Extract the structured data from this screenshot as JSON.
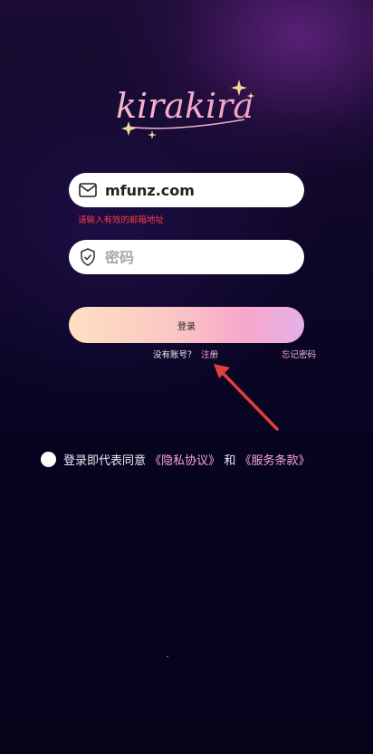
{
  "brand": {
    "logo_text": "kirakira"
  },
  "email": {
    "value": "mfunz.com",
    "icon": "mail-icon",
    "error": "请输入有效的邮箱地址"
  },
  "password": {
    "placeholder": "密码",
    "icon": "shield-icon"
  },
  "login": {
    "label": "登录"
  },
  "register": {
    "prompt": "没有账号？",
    "link": "注册",
    "forgot": "忘记密码"
  },
  "agreement": {
    "prefix": "登录即代表同意",
    "privacy": "《隐私协议》",
    "conjunction": "和",
    "terms": "《服务条款》"
  },
  "colors": {
    "accent_pink": "#f7a7d0",
    "error_red": "#ff3a4a",
    "arrow_red": "#e0403a"
  }
}
